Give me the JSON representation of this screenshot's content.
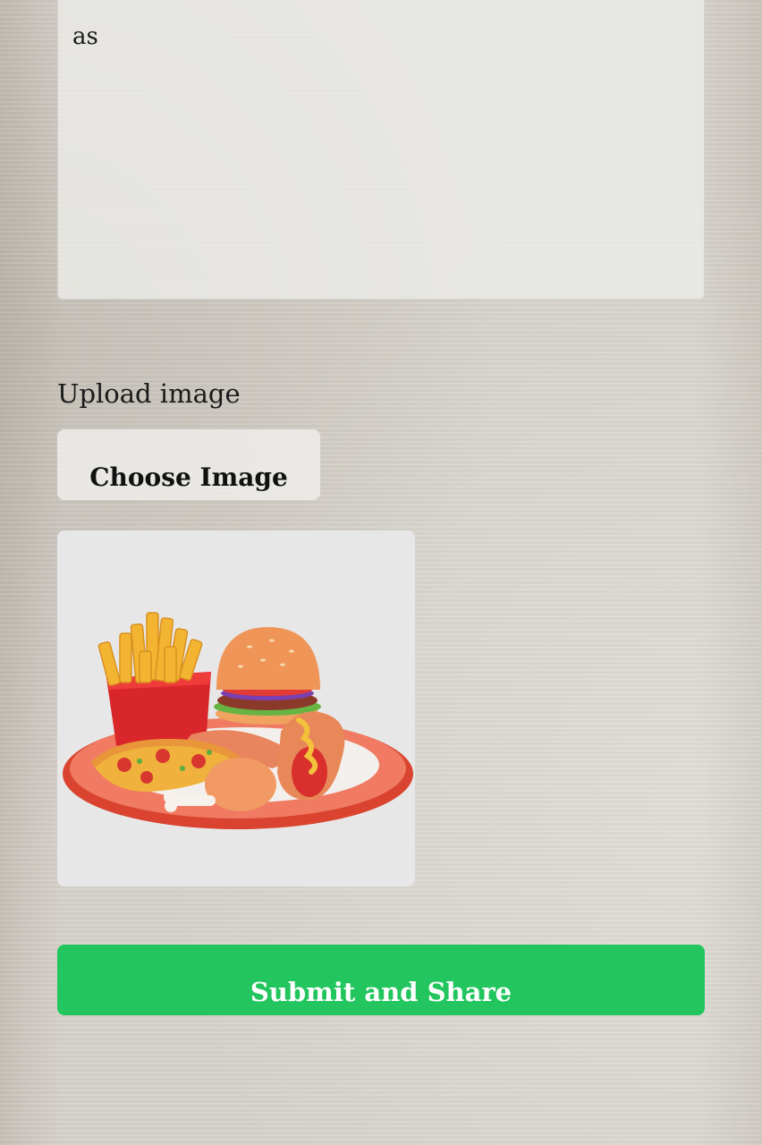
{
  "form": {
    "textarea_value": "as",
    "upload_label": "Upload image",
    "choose_button_label": "Choose Image",
    "submit_button_label": "Submit and Share"
  },
  "preview": {
    "subject": "fast-food plate: fries, burger, hot dog, pizza slice, chicken drumsticks"
  },
  "colors": {
    "submit_bg": "#22c55e",
    "submit_text": "#ffffff",
    "preview_bg": "#e7e7e7"
  }
}
